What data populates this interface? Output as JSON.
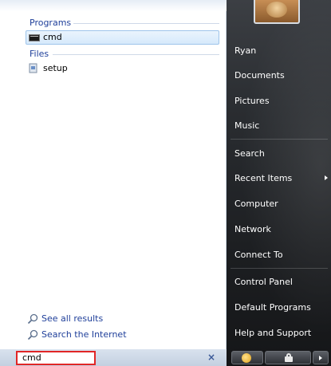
{
  "results": {
    "programs_header": "Programs",
    "files_header": "Files",
    "programs": [
      {
        "label": "cmd",
        "icon": "cmd-icon",
        "selected": true
      }
    ],
    "files": [
      {
        "label": "setup",
        "icon": "setup-icon"
      }
    ]
  },
  "links": {
    "see_all": "See all results",
    "search_internet": "Search the Internet"
  },
  "search": {
    "value": "cmd",
    "clear_icon": "×"
  },
  "right_menu": {
    "items": [
      "Ryan",
      "Documents",
      "Pictures",
      "Music",
      "Search",
      "Recent Items",
      "Computer",
      "Network",
      "Connect To",
      "Control Panel",
      "Default Programs",
      "Help and Support"
    ]
  },
  "colors": {
    "accent_blue": "#1f3f9a",
    "search_border": "#e12626",
    "right_pane": "#2a2d31"
  }
}
